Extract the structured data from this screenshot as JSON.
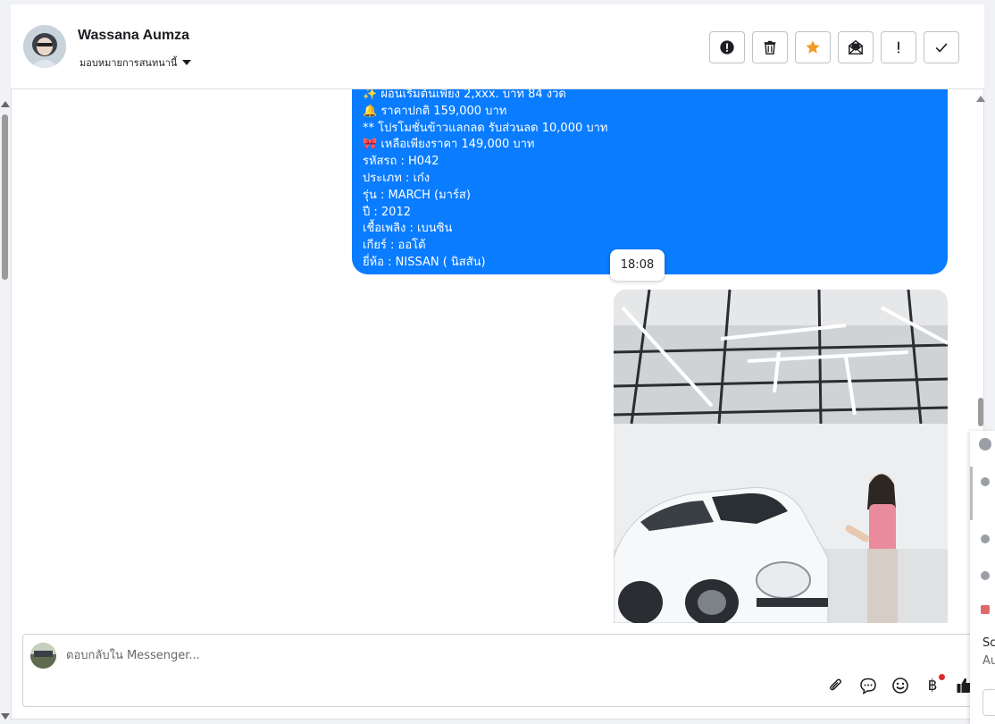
{
  "header": {
    "contact_name": "Wassana Aumza",
    "assign_label": "มอบหมายการสนทนานี้",
    "actions": [
      {
        "name": "report-button",
        "icon": "exclamation-circle-icon"
      },
      {
        "name": "delete-button",
        "icon": "trash-icon"
      },
      {
        "name": "star-button",
        "icon": "star-icon"
      },
      {
        "name": "mark-unread-button",
        "icon": "open-envelope-icon"
      },
      {
        "name": "follow-up-button",
        "icon": "exclamation-icon"
      },
      {
        "name": "mark-done-button",
        "icon": "check-icon"
      }
    ]
  },
  "message": {
    "lines": [
      "✨ ผ่อนเริ่มต้นเพียง 2,xxx. บาท 84 งวด",
      "🔔 ราคาปกติ 159,000 บาท",
      "** โปรโมชั่นข้าวแลกลด รับส่วนลด 10,000 บาท",
      "🎀 เหลือเพียงราคา 149,000 บาท",
      "รหัสรถ : H042",
      "ประเภท : เก๋ง",
      "รุ่น : MARCH (มาร์ส)",
      "ปี : 2012",
      "เชื้อเพลิง : เบนซิน",
      "เกียร์ : ออโต้",
      "ยี่ห้อ : NISSAN ( นิสสัน)"
    ],
    "time": "18:08"
  },
  "composer": {
    "placeholder": "ตอบกลับใน Messenger...",
    "tools": [
      "paperclip-icon",
      "chat-bubble-icon",
      "smiley-icon",
      "baht-icon",
      "thumbs-up-icon"
    ],
    "baht_symbol": "฿"
  },
  "side_panel": {
    "text_1": "Sc",
    "text_2": "Au"
  },
  "colors": {
    "bubble": "#0a7cff",
    "star": "#f29b27",
    "badge_dot": "#e02b2b"
  }
}
